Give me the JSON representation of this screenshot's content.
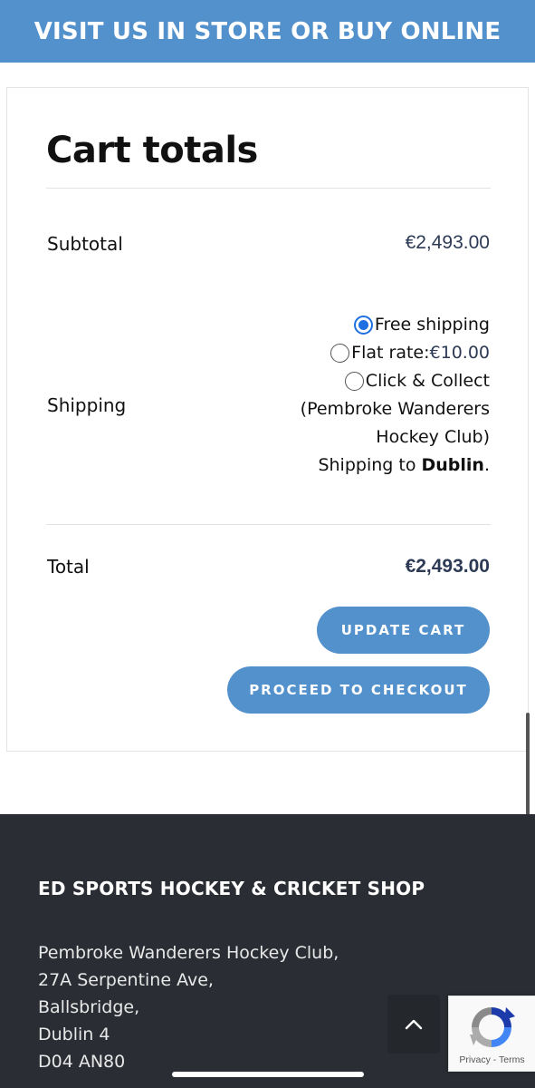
{
  "promo": {
    "text": "VISIT US IN STORE OR BUY ONLINE"
  },
  "cart": {
    "title": "Cart totals",
    "subtotal": {
      "label": "Subtotal",
      "amount": "€2,493.00"
    },
    "shipping": {
      "label": "Shipping",
      "options": [
        {
          "label": "Free shipping",
          "selected": true
        },
        {
          "label": "Flat rate: ",
          "price": "€10.00",
          "selected": false
        },
        {
          "label": "Click & Collect",
          "selected": false
        }
      ],
      "collect_line1": "(Pembroke Wanderers",
      "collect_line2": "Hockey Club)",
      "destination_prefix": "Shipping to ",
      "destination": "Dublin",
      "destination_suffix": "."
    },
    "total": {
      "label": "Total",
      "amount": "€2,493.00"
    },
    "update_button": "UPDATE CART",
    "checkout_button": "PROCEED TO CHECKOUT"
  },
  "footer": {
    "title": "ED SPORTS HOCKEY & CRICKET SHOP",
    "address": [
      "Pembroke Wanderers Hockey Club,",
      "27A Serpentine Ave,",
      "Ballsbridge,",
      "Dublin 4",
      "D04 AN80"
    ]
  },
  "recaptcha": {
    "privacy": "Privacy",
    "separator": " - ",
    "terms": "Terms"
  },
  "colors": {
    "accent": "#5391cc",
    "footer_bg": "#2a2d33",
    "price": "#2d3a55",
    "radio_selected": "#1e6fe0"
  },
  "icons": {
    "back_to_top": "chevron-up-icon",
    "recaptcha": "recaptcha-icon"
  }
}
